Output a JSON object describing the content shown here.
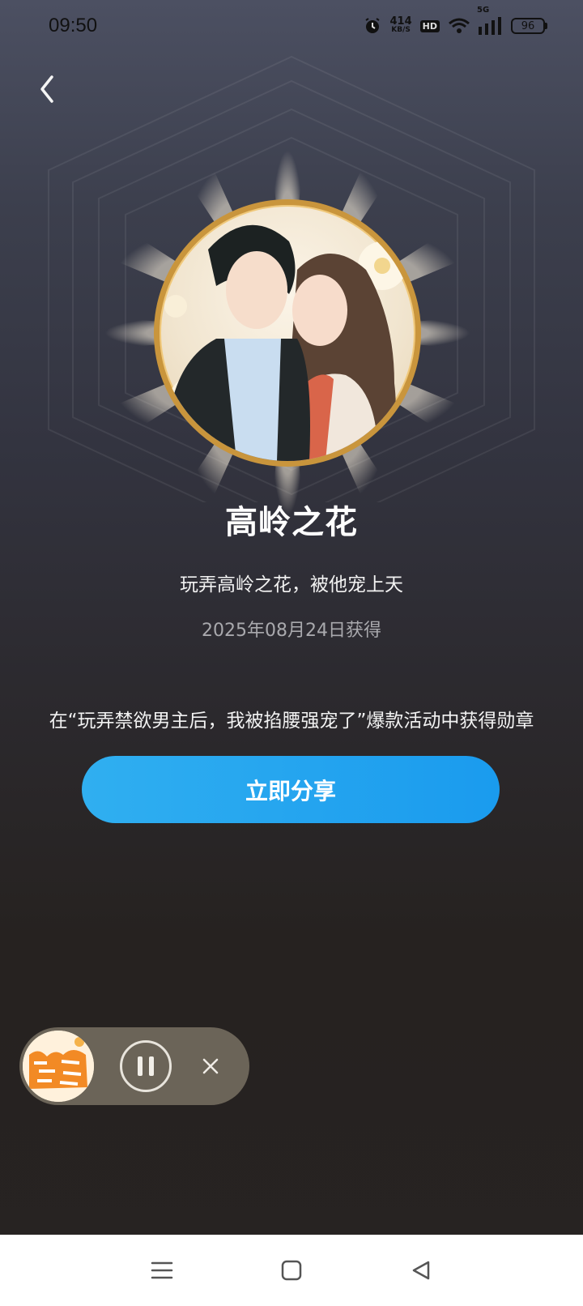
{
  "status_bar": {
    "time": "09:50",
    "net_speed_value": "414",
    "net_speed_unit": "KB/S",
    "hd_label": "HD",
    "signal_label": "5G",
    "battery_level": "96"
  },
  "badge": {
    "title": "高岭之花",
    "subtitle": "玩弄高岭之花，被他宠上天",
    "date": "2025年08月24日获得"
  },
  "activity_text": "在“玩弄禁欲男主后，我被掐腰强宠了”爆款活动中获得勋章",
  "share_label": "立即分享",
  "colors": {
    "accent": "#1a9bee",
    "badge_ring": "#c9953c"
  },
  "icons": {
    "back": "chevron-left-icon",
    "pause": "pause-icon",
    "close": "close-icon",
    "nav_menu": "menu-icon",
    "nav_home": "home-icon",
    "nav_back": "back-triangle-icon"
  }
}
